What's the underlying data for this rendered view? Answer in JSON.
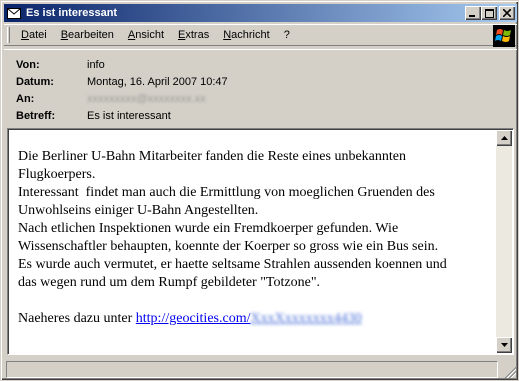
{
  "window": {
    "title": "Es ist interessant",
    "controls": {
      "minimize": "_",
      "maximize": "□",
      "close": "×"
    }
  },
  "menu": {
    "items": [
      "Datei",
      "Bearbeiten",
      "Ansicht",
      "Extras",
      "Nachricht",
      "?"
    ]
  },
  "headers": {
    "from_label": "Von:",
    "from_value": "info",
    "date_label": "Datum:",
    "date_value": "Montag, 16. April 2007 10:47",
    "to_label": "An:",
    "to_value": "xxxxxxxxx@xxxxxxxx.xx",
    "subject_label": "Betreff:",
    "subject_value": "Es ist interessant"
  },
  "message": {
    "lines": [
      "Die Berliner U-Bahn Mitarbeiter fanden die Reste eines unbekannten",
      "Flugkoerpers.",
      "Interessant  findet man auch die Ermittlung von moeglichen Gruenden des",
      "Unwohlseins einiger U-Bahn Angestellten.",
      "Nach etlichen Inspektionen wurde ein Fremdkoerper gefunden. Wie",
      "Wissenschaftler behaupten, koennte der Koerper so gross wie ein Bus sein.",
      "Es wurde auch vermutet, er haette seltsame Strahlen aussenden koennen und",
      "das wegen rund um dem Rumpf gebildeter \"Totzone\"."
    ],
    "link_prefix": "Naeheres dazu unter ",
    "link_visible": "http://geocities.com/",
    "link_obscured": "XxxXxxxxxxx4430"
  },
  "icons": {
    "title_icon": "envelope-icon",
    "logo": "windows-logo-icon"
  }
}
